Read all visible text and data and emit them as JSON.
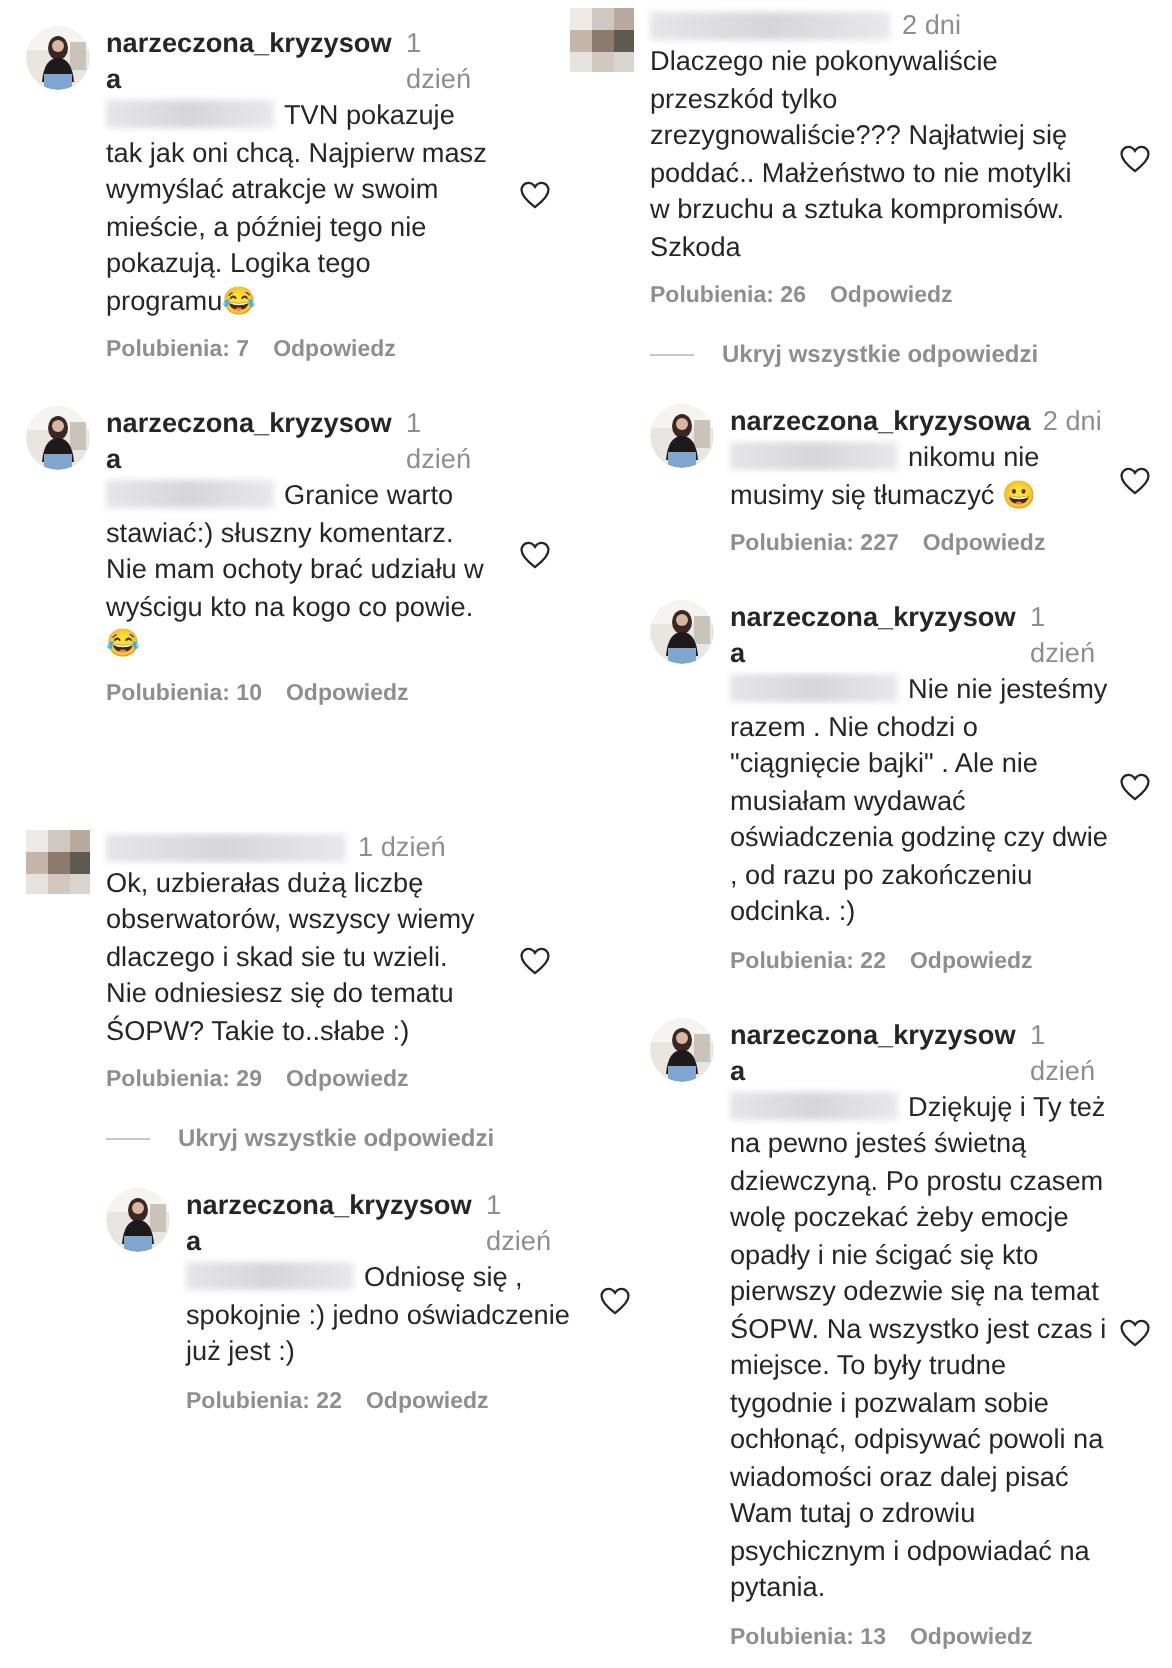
{
  "columns": [
    {
      "blocks": [
        {
          "items": [
            {
              "kind": "comment",
              "reply": false,
              "avatar_blurred": false,
              "author": "narzeczona_kryzysowa",
              "time": "1 dzień",
              "mention_blurred": true,
              "text": "TVN pokazuje tak jak oni chcą. Najpierw masz wymyślać atrakcje w swoim mieście, a później tego nie pokazują. Logika tego programu😂",
              "likes": "Polubienia: 7",
              "reply_label": "Odpowiedz"
            },
            {
              "kind": "comment",
              "reply": false,
              "avatar_blurred": false,
              "author": "narzeczona_kryzysowa",
              "time": "1 dzień",
              "mention_blurred": true,
              "text": "Granice warto stawiać:) słuszny komentarz. Nie mam ochoty brać udziału w wyścigu kto na kogo co powie. 😂",
              "likes": "Polubienia: 10",
              "reply_label": "Odpowiedz"
            }
          ]
        },
        {
          "items": [
            {
              "kind": "comment",
              "reply": false,
              "avatar_blurred": true,
              "time": "1 dzień",
              "mention_blurred": false,
              "text": "Ok, uzbierałas dużą liczbę obserwatorów, wszyscy wiemy dlaczego i skad sie tu wzieli. Nie odniesiesz się do tematu ŚOPW? Takie to..słabe :)",
              "likes": "Polubienia: 29",
              "reply_label": "Odpowiedz"
            },
            {
              "kind": "toggle",
              "label": "Ukryj wszystkie odpowiedzi"
            },
            {
              "kind": "comment",
              "reply": true,
              "avatar_blurred": false,
              "author": "narzeczona_kryzysowa",
              "time": "1 dzień",
              "mention_blurred": true,
              "text": "Odniosę się , spokojnie :) jedno oświadczenie już jest :)",
              "likes": "Polubienia: 22",
              "reply_label": "Odpowiedz"
            }
          ]
        }
      ]
    },
    {
      "blocks": [
        {
          "items": [
            {
              "kind": "comment",
              "reply": false,
              "avatar_blurred": true,
              "time": "2 dni",
              "mention_blurred": false,
              "text": "Dlaczego nie pokonywaliście przeszkód tylko zrezygnowaliście??? Najłatwiej się poddać.. Małżeństwo to nie motylki w brzuchu a sztuka kompromisów. Szkoda",
              "likes": "Polubienia: 26",
              "reply_label": "Odpowiedz"
            },
            {
              "kind": "toggle",
              "label": "Ukryj wszystkie odpowiedzi"
            },
            {
              "kind": "comment",
              "reply": true,
              "avatar_blurred": false,
              "author": "narzeczona_kryzysowa",
              "time": "2 dni",
              "mention_blurred": true,
              "text": "nikomu nie musimy się tłumaczyć 😀",
              "likes": "Polubienia: 227",
              "reply_label": "Odpowiedz"
            },
            {
              "kind": "comment",
              "reply": true,
              "avatar_blurred": false,
              "author": "narzeczona_kryzysowa",
              "time": "1 dzień",
              "mention_blurred": true,
              "text": "Nie nie jesteśmy razem . Nie chodzi o \"ciągnięcie bajki\" . Ale nie musiałam wydawać oświadczenia godzinę czy dwie , od razu po zakończeniu odcinka. :)",
              "likes": "Polubienia: 22",
              "reply_label": "Odpowiedz"
            },
            {
              "kind": "comment",
              "reply": true,
              "avatar_blurred": false,
              "author": "narzeczona_kryzysowa",
              "time": "1 dzień",
              "mention_blurred": true,
              "text": "Dziękuję i Ty też na pewno jesteś świetną dziewczyną. Po prostu czasem wolę poczekać żeby emocje opadły i nie ścigać się kto pierwszy odezwie się na temat ŚOPW. Na wszystko jest czas i miejsce. To były trudne tygodnie i pozwalam sobie ochłonąć, odpisywać powoli na wiadomości oraz dalej pisać Wam tutaj o zdrowiu psychicznym i odpowiadać na pytania.",
              "likes": "Polubienia: 13",
              "reply_label": "Odpowiedz"
            }
          ]
        }
      ]
    }
  ]
}
